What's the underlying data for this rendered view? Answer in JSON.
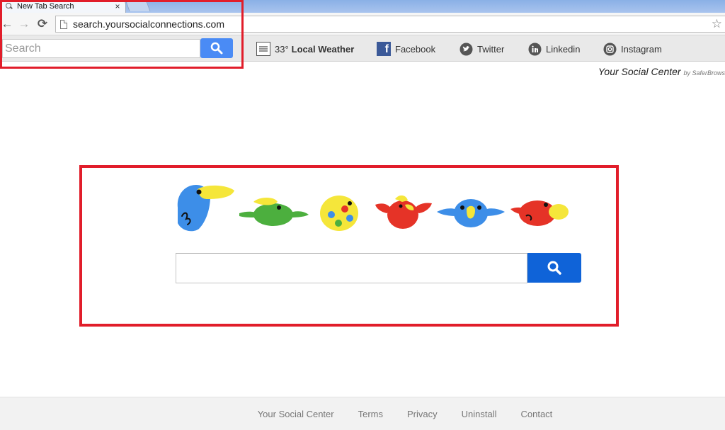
{
  "browser": {
    "tab": {
      "title": "New Tab Search",
      "close_glyph": "×"
    },
    "nav": {
      "back_glyph": "←",
      "forward_glyph": "→",
      "reload_glyph": "⟳"
    },
    "address_bar": {
      "url": "search.yoursocialconnections.com"
    },
    "bookmark_glyph": "☆"
  },
  "toolbar_extension": {
    "search_placeholder": "Search",
    "weather": {
      "temperature": "33°",
      "label": "Local Weather"
    },
    "links": [
      {
        "label": "Facebook",
        "icon": "facebook-icon"
      },
      {
        "label": "Twitter",
        "icon": "twitter-icon"
      },
      {
        "label": "Linkedin",
        "icon": "linkedin-icon"
      },
      {
        "label": "Instagram",
        "icon": "instagram-icon"
      }
    ]
  },
  "branding": {
    "title": "Your Social Center",
    "by": "by SaferBrows"
  },
  "main": {
    "search_value": ""
  },
  "footer": {
    "links": [
      "Your Social Center",
      "Terms",
      "Privacy",
      "Uninstall",
      "Contact"
    ]
  },
  "colors": {
    "annotation_red": "#e11d2a",
    "search_blue": "#0f63d8",
    "toolbar_search_blue": "#4a8bf5",
    "bird_blue": "#3d8ee8",
    "bird_green": "#4caf3e",
    "bird_yellow": "#f5e63a",
    "bird_red": "#e53327"
  }
}
